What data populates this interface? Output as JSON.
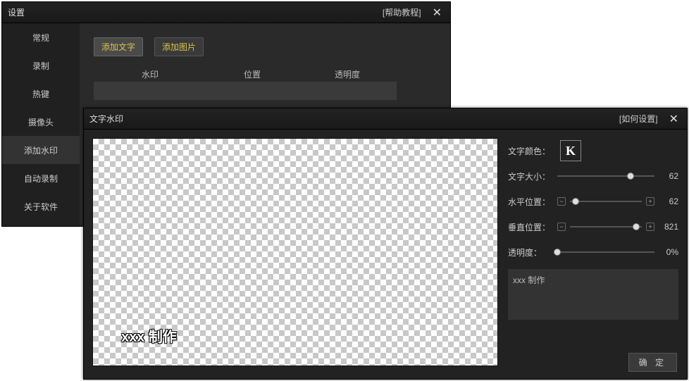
{
  "settings": {
    "title": "设置",
    "help": "[帮助教程]",
    "sidebar": [
      "常规",
      "录制",
      "热键",
      "摄像头",
      "添加水印",
      "自动录制",
      "关于软件"
    ],
    "active_sidebar_index": 4,
    "buttons": {
      "add_text": "添加文字",
      "add_image": "添加图片"
    },
    "table_headers": {
      "c1": "水印",
      "c2": "位置",
      "c3": "透明度"
    }
  },
  "textwm": {
    "title": "文字水印",
    "help": "[如何设置]",
    "preview_text": "xxx 制作",
    "color_label": "文字颜色：",
    "color_glyph": "K",
    "size_label": "文字大小：",
    "size_value": "62",
    "hpos_label": "水平位置：",
    "hpos_value": "62",
    "vpos_label": "垂直位置：",
    "vpos_value": "821",
    "opacity_label": "透明度：",
    "opacity_value": "0%",
    "text_value": "xxx 制作",
    "ok": "确 定",
    "slider_pos": {
      "size": 75,
      "hpos": 8,
      "vpos": 92,
      "opacity": 0
    }
  }
}
